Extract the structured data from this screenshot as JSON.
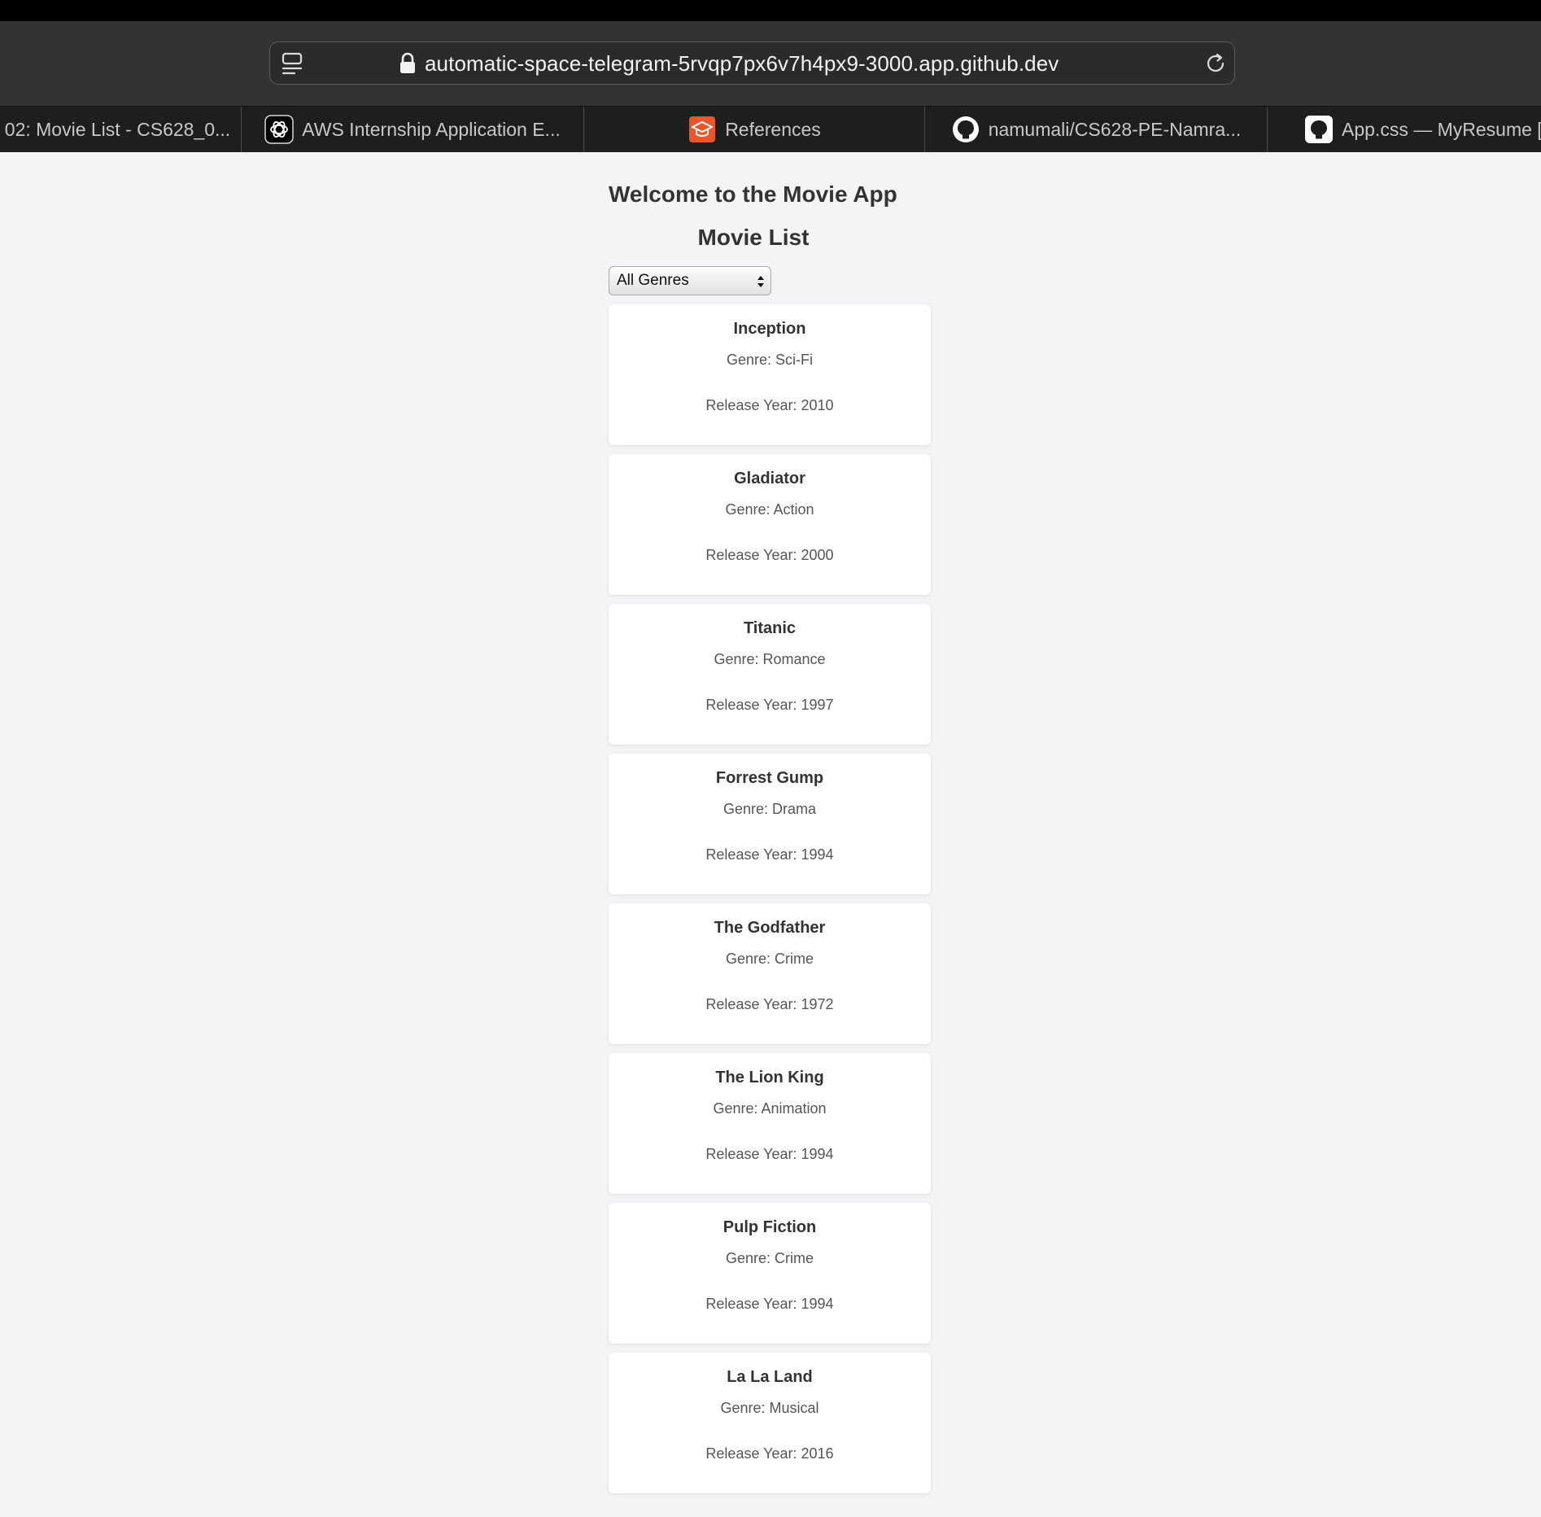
{
  "browser": {
    "url": "automatic-space-telegram-5rvqp7px6v7h4px9-3000.app.github.dev",
    "tabs": [
      {
        "label": "02: Movie List - CS628_0...",
        "icon": "none"
      },
      {
        "label": "AWS Internship Application E...",
        "icon": "chatgpt-icon"
      },
      {
        "label": "References",
        "icon": "graduation-cap-icon"
      },
      {
        "label": "namumali/CS628-PE-Namra...",
        "icon": "github-icon"
      },
      {
        "label": "App.css — MyResume [C",
        "icon": "github-icon"
      }
    ]
  },
  "page": {
    "title": "Welcome to the Movie App",
    "subtitle": "Movie List",
    "genre_filter": {
      "selected": "All Genres"
    },
    "movies": [
      {
        "title": "Inception",
        "genre": "Genre: Sci-Fi",
        "year": "Release Year: 2010"
      },
      {
        "title": "Gladiator",
        "genre": "Genre: Action",
        "year": "Release Year: 2000"
      },
      {
        "title": "Titanic",
        "genre": "Genre: Romance",
        "year": "Release Year: 1997"
      },
      {
        "title": "Forrest Gump",
        "genre": "Genre: Drama",
        "year": "Release Year: 1994"
      },
      {
        "title": "The Godfather",
        "genre": "Genre: Crime",
        "year": "Release Year: 1972"
      },
      {
        "title": "The Lion King",
        "genre": "Genre: Animation",
        "year": "Release Year: 1994"
      },
      {
        "title": "Pulp Fiction",
        "genre": "Genre: Crime",
        "year": "Release Year: 1994"
      },
      {
        "title": "La La Land",
        "genre": "Genre: Musical",
        "year": "Release Year: 2016"
      }
    ]
  },
  "colors": {
    "page_background": "#f4f4f7",
    "card_background": "#ffffff",
    "toolbar": "#333333",
    "tabbar": "#1e1e1e",
    "references_icon": "#e8562a"
  }
}
